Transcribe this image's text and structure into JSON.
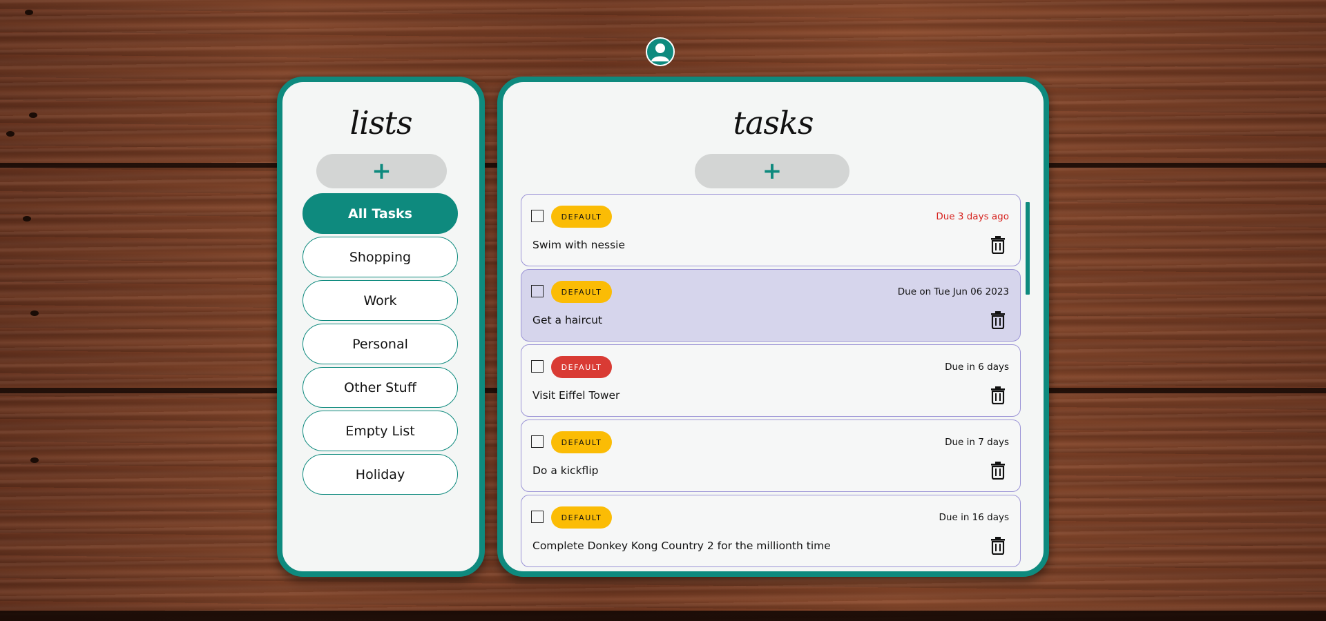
{
  "user": {
    "avatar_icon": "user-avatar-icon"
  },
  "lists_panel": {
    "title": "lists",
    "add_label": "+",
    "items": [
      {
        "label": "All Tasks",
        "active": true
      },
      {
        "label": "Shopping",
        "active": false
      },
      {
        "label": "Work",
        "active": false
      },
      {
        "label": "Personal",
        "active": false
      },
      {
        "label": "Other Stuff",
        "active": false
      },
      {
        "label": "Empty List",
        "active": false
      },
      {
        "label": "Holiday",
        "active": false
      }
    ]
  },
  "tasks_panel": {
    "title": "tasks",
    "add_label": "+",
    "tasks": [
      {
        "name": "Swim with nessie",
        "tag": "DEFAULT",
        "tag_color": "#fbbc05",
        "due": "Due 3 days ago",
        "overdue": true,
        "selected": false
      },
      {
        "name": "Get a haircut",
        "tag": "DEFAULT",
        "tag_color": "#fbbc05",
        "due": "Due on Tue Jun 06 2023",
        "overdue": false,
        "selected": true
      },
      {
        "name": "Visit Eiffel Tower",
        "tag": "DEFAULT",
        "tag_color": "#d93b34",
        "due": "Due in 6 days",
        "overdue": false,
        "selected": false
      },
      {
        "name": "Do a kickflip",
        "tag": "DEFAULT",
        "tag_color": "#fbbc05",
        "due": "Due in 7 days",
        "overdue": false,
        "selected": false
      },
      {
        "name": "Complete Donkey Kong Country 2 for the millionth time",
        "tag": "DEFAULT",
        "tag_color": "#fbbc05",
        "due": "Due in 16 days",
        "overdue": false,
        "selected": false
      }
    ]
  },
  "colors": {
    "accent": "#0e8a7e",
    "overdue": "#d6231f",
    "selected_task_bg": "#d6d5ec",
    "task_border": "#9b93d6",
    "add_button_bg": "#d3d5d4"
  },
  "icons": {
    "add": "plus-icon",
    "delete": "trash-icon",
    "checkbox": "checkbox-icon"
  }
}
